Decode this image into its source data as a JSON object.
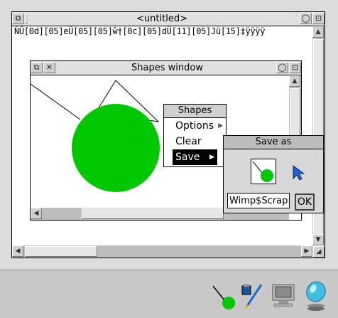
{
  "main_window": {
    "title": "<untitled>",
    "text": "ǸÜ[0d][05]eÜ[05][05]ŵ†[0c][05]dÜ[11][05]Jü[15]‡ÿÿÿÿ"
  },
  "shapes_window": {
    "title": "Shapes window"
  },
  "menu": {
    "title": "Shapes",
    "items": [
      {
        "label": "Options",
        "submenu": true
      },
      {
        "label": "Clear",
        "submenu": false
      },
      {
        "label": "Save",
        "submenu": true
      }
    ]
  },
  "save_dialog": {
    "title": "Save as",
    "filename": "Wimp$Scrap:",
    "ok_label": "OK"
  },
  "colors": {
    "circle": "#00c800",
    "pointer": "#2060d0"
  },
  "icons": [
    "shapes-app-icon",
    "paint-icon",
    "monitor-icon",
    "discs-icon"
  ]
}
